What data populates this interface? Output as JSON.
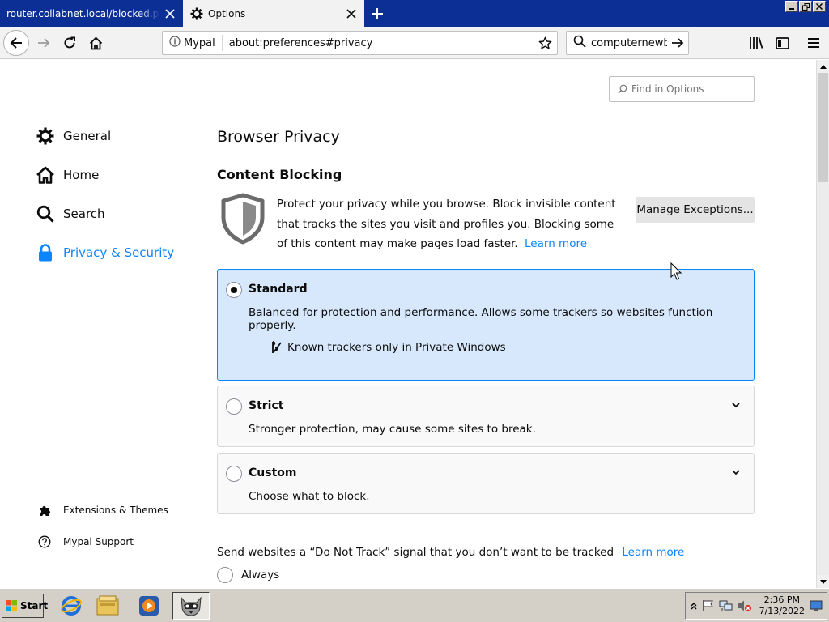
{
  "browser": {
    "tabs": [
      {
        "label": "router.collabnet.local/blocked.php?dienst=",
        "active": false
      },
      {
        "label": "Options",
        "active": true
      }
    ],
    "identity_label": "Mypal",
    "url": "about:preferences#privacy",
    "search_value": "computernewb.",
    "icons": [
      "back-icon",
      "forward-icon",
      "reload-icon",
      "home-icon",
      "info-icon",
      "star-icon",
      "search-icon",
      "arrow-right-icon",
      "library-icon",
      "sidebar-icon",
      "menu-icon"
    ]
  },
  "sidebar": {
    "items": [
      {
        "label": "General",
        "icon": "gear-icon"
      },
      {
        "label": "Home",
        "icon": "home-icon"
      },
      {
        "label": "Search",
        "icon": "search-icon"
      },
      {
        "label": "Privacy & Security",
        "icon": "lock-icon",
        "selected": true
      }
    ],
    "footer": [
      {
        "label": "Extensions & Themes",
        "icon": "puzzle-icon"
      },
      {
        "label": "Mypal Support",
        "icon": "help-icon"
      }
    ]
  },
  "main": {
    "find_placeholder": "Find in Options",
    "title": "Browser Privacy",
    "section_title": "Content Blocking",
    "description": "Protect your privacy while you browse. Block invisible content that tracks the sites you visit and profiles you. Blocking some of this content may make pages load faster.",
    "learn_more": "Learn more",
    "manage_exceptions": "Manage Exceptions...",
    "options": [
      {
        "title": "Standard",
        "description": "Balanced for protection and performance. Allows some trackers so websites function properly.",
        "detail": "Known trackers only in Private Windows",
        "selected": true
      },
      {
        "title": "Strict",
        "description": "Stronger protection, may cause some sites to break.",
        "selected": false
      },
      {
        "title": "Custom",
        "description": "Choose what to block.",
        "selected": false
      }
    ],
    "dnt_text": "Send websites a “Do Not Track” signal that you don’t want to be tracked",
    "dnt_learn_more": "Learn more",
    "dnt_always": "Always"
  },
  "taskbar": {
    "start_label": "Start",
    "clock_time": "2:36 PM",
    "clock_date": "7/13/2022"
  },
  "colors": {
    "accent": "#0a84ff",
    "selected_option_bg": "#d7e8fc",
    "tabstrip": "#0c2f96"
  }
}
